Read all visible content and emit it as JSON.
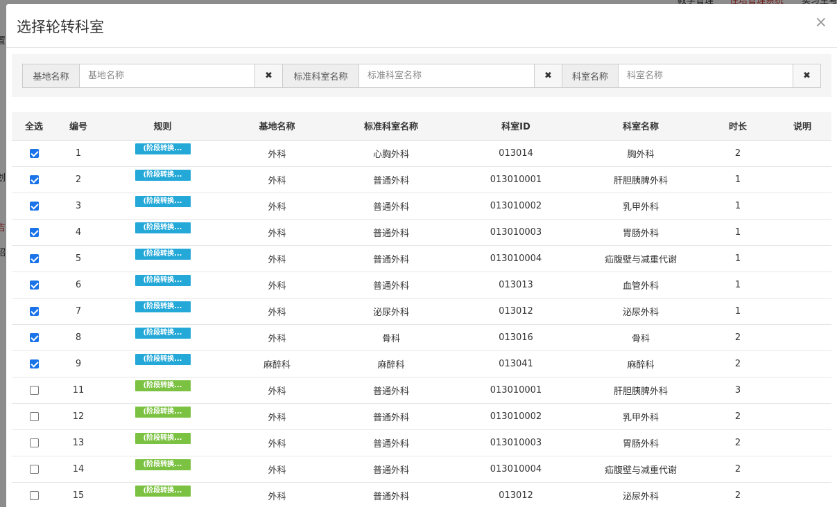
{
  "background": {
    "menu_items": [
      "教学管理",
      "住培管理系统",
      "实习生考"
    ],
    "left_fragments": [
      "置",
      "划",
      "吉",
      "绍"
    ]
  },
  "modal": {
    "title": "选择轮转科室",
    "close_icon": "×"
  },
  "filters": [
    {
      "label": "基地名称",
      "placeholder": "基地名称",
      "value": "",
      "clear_icon": "✖"
    },
    {
      "label": "标准科室名称",
      "placeholder": "标准科室名称",
      "value": "",
      "clear_icon": "✖"
    },
    {
      "label": "科室名称",
      "placeholder": "科室名称",
      "value": "",
      "clear_icon": "✖"
    }
  ],
  "table": {
    "headers": [
      "全选",
      "编号",
      "规则",
      "基地名称",
      "标准科室名称",
      "科室ID",
      "科室名称",
      "时长",
      "说明"
    ],
    "rows": [
      {
        "checked": true,
        "no": "1",
        "rule": "(阶段转换...",
        "rule_color": "blue",
        "base": "外科",
        "std_dept": "心胸外科",
        "dept_id": "013014",
        "dept_name": "胸外科",
        "duration": "2",
        "note": ""
      },
      {
        "checked": true,
        "no": "2",
        "rule": "(阶段转换...",
        "rule_color": "blue",
        "base": "外科",
        "std_dept": "普通外科",
        "dept_id": "013010001",
        "dept_name": "肝胆胰脾外科",
        "duration": "1",
        "note": ""
      },
      {
        "checked": true,
        "no": "3",
        "rule": "(阶段转换...",
        "rule_color": "blue",
        "base": "外科",
        "std_dept": "普通外科",
        "dept_id": "013010002",
        "dept_name": "乳甲外科",
        "duration": "1",
        "note": ""
      },
      {
        "checked": true,
        "no": "4",
        "rule": "(阶段转换...",
        "rule_color": "blue",
        "base": "外科",
        "std_dept": "普通外科",
        "dept_id": "013010003",
        "dept_name": "胃肠外科",
        "duration": "1",
        "note": ""
      },
      {
        "checked": true,
        "no": "5",
        "rule": "(阶段转换...",
        "rule_color": "blue",
        "base": "外科",
        "std_dept": "普通外科",
        "dept_id": "013010004",
        "dept_name": "疝腹壁与减重代谢",
        "duration": "1",
        "note": ""
      },
      {
        "checked": true,
        "no": "6",
        "rule": "(阶段转换...",
        "rule_color": "blue",
        "base": "外科",
        "std_dept": "普通外科",
        "dept_id": "013013",
        "dept_name": "血管外科",
        "duration": "1",
        "note": ""
      },
      {
        "checked": true,
        "no": "7",
        "rule": "(阶段转换...",
        "rule_color": "blue",
        "base": "外科",
        "std_dept": "泌尿外科",
        "dept_id": "013012",
        "dept_name": "泌尿外科",
        "duration": "1",
        "note": ""
      },
      {
        "checked": true,
        "no": "8",
        "rule": "(阶段转换...",
        "rule_color": "blue",
        "base": "外科",
        "std_dept": "骨科",
        "dept_id": "013016",
        "dept_name": "骨科",
        "duration": "2",
        "note": ""
      },
      {
        "checked": true,
        "no": "9",
        "rule": "(阶段转换...",
        "rule_color": "blue",
        "base": "麻醉科",
        "std_dept": "麻醉科",
        "dept_id": "013041",
        "dept_name": "麻醉科",
        "duration": "2",
        "note": ""
      },
      {
        "checked": false,
        "no": "11",
        "rule": "(阶段转换...",
        "rule_color": "green",
        "base": "外科",
        "std_dept": "普通外科",
        "dept_id": "013010001",
        "dept_name": "肝胆胰脾外科",
        "duration": "3",
        "note": ""
      },
      {
        "checked": false,
        "no": "12",
        "rule": "(阶段转换...",
        "rule_color": "green",
        "base": "外科",
        "std_dept": "普通外科",
        "dept_id": "013010002",
        "dept_name": "乳甲外科",
        "duration": "2",
        "note": ""
      },
      {
        "checked": false,
        "no": "13",
        "rule": "(阶段转换...",
        "rule_color": "green",
        "base": "外科",
        "std_dept": "普通外科",
        "dept_id": "013010003",
        "dept_name": "胃肠外科",
        "duration": "2",
        "note": ""
      },
      {
        "checked": false,
        "no": "14",
        "rule": "(阶段转换...",
        "rule_color": "green",
        "base": "外科",
        "std_dept": "普通外科",
        "dept_id": "013010004",
        "dept_name": "疝腹壁与减重代谢",
        "duration": "2",
        "note": ""
      },
      {
        "checked": false,
        "no": "15",
        "rule": "(阶段转换...",
        "rule_color": "green",
        "base": "外科",
        "std_dept": "普通外科",
        "dept_id": "013012",
        "dept_name": "泌尿外科",
        "duration": "2",
        "note": ""
      }
    ]
  },
  "colors": {
    "rule_blue": "#23a8d8",
    "rule_green": "#7cc242",
    "checkbox_checked": "#1a73e8"
  }
}
